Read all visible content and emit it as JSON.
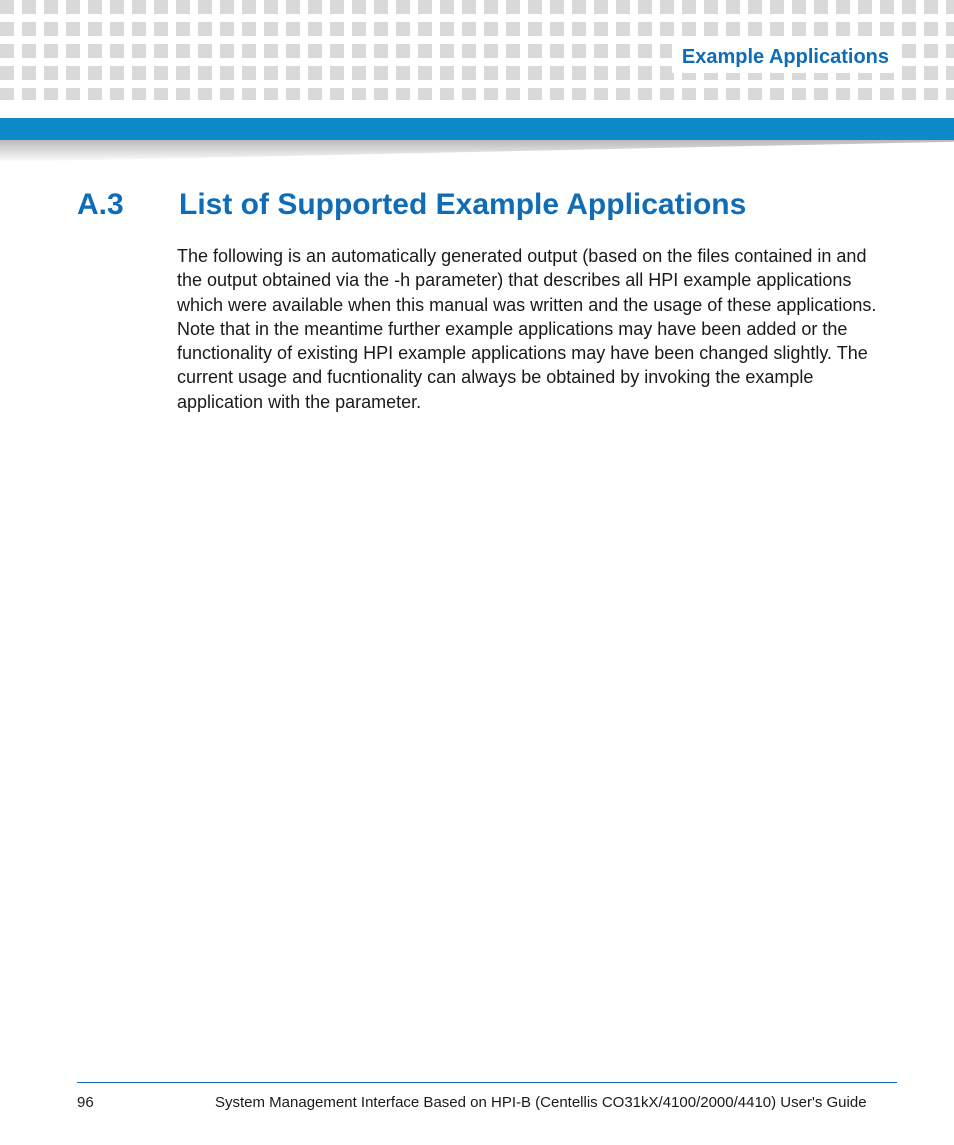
{
  "header": {
    "running_title": "Example Applications"
  },
  "section": {
    "number": "A.3",
    "title": "List of Supported Example Applications",
    "body": "The following is an automatically generated output (based on the files contained in                                                   and the output obtained via the -h parameter) that describes all HPI example applications which were available when this manual was written and the usage of these applications. Note that in the meantime further example applications may have been added or the functionality of existing HPI example applications may have been changed slightly. The current usage and fucntionality can always be obtained by invoking the example application with the        parameter."
  },
  "footer": {
    "page_number": "96",
    "doc_title": "System Management Interface Based on HPI-B (Centellis CO31kX/4100/2000/4410) User's Guide"
  }
}
